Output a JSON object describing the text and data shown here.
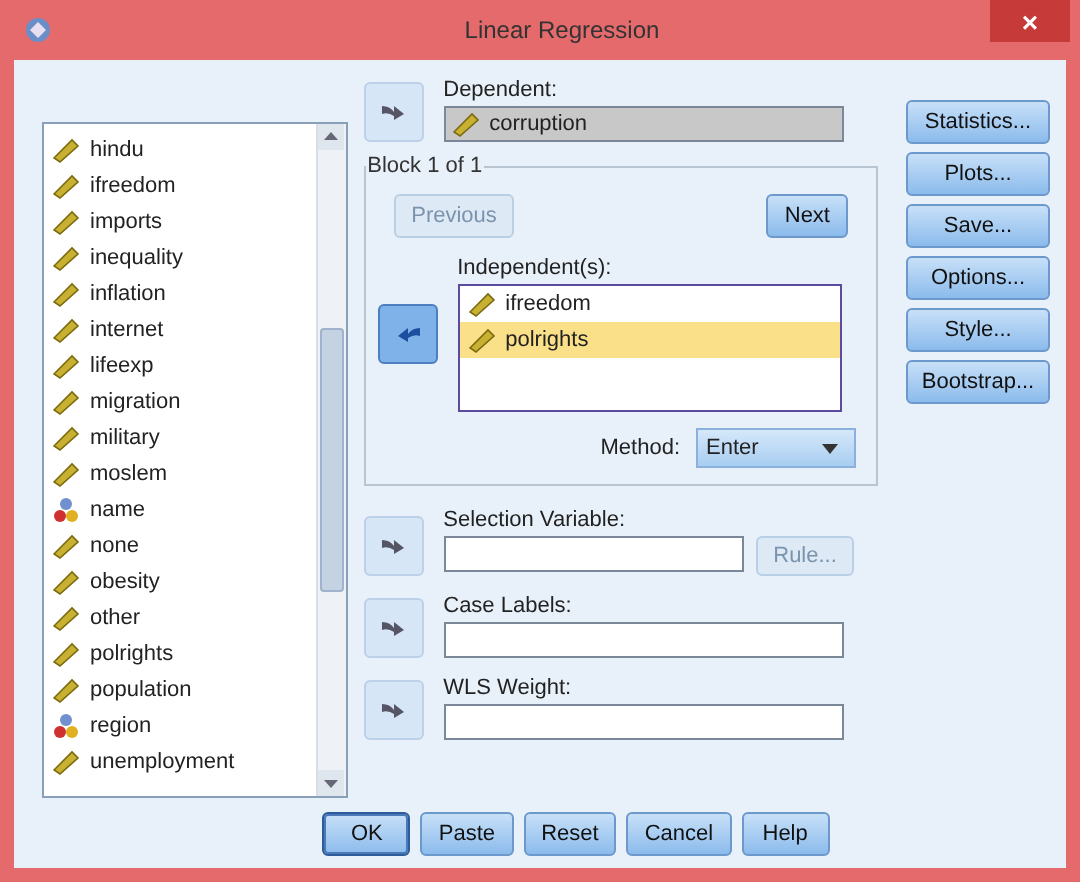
{
  "window": {
    "title": "Linear Regression",
    "close": "×"
  },
  "variables": [
    {
      "name": "hindu",
      "kind": "scale",
      "selected": false
    },
    {
      "name": "ifreedom",
      "kind": "scale",
      "selected": false
    },
    {
      "name": "imports",
      "kind": "scale",
      "selected": false
    },
    {
      "name": "inequality",
      "kind": "scale",
      "selected": false
    },
    {
      "name": "inflation",
      "kind": "scale",
      "selected": false
    },
    {
      "name": "internet",
      "kind": "scale",
      "selected": false
    },
    {
      "name": "lifeexp",
      "kind": "scale",
      "selected": false
    },
    {
      "name": "migration",
      "kind": "scale",
      "selected": false
    },
    {
      "name": "military",
      "kind": "scale",
      "selected": false
    },
    {
      "name": "moslem",
      "kind": "scale",
      "selected": false
    },
    {
      "name": "name",
      "kind": "nominal",
      "selected": false
    },
    {
      "name": "none",
      "kind": "scale",
      "selected": false
    },
    {
      "name": "obesity",
      "kind": "scale",
      "selected": false
    },
    {
      "name": "other",
      "kind": "scale",
      "selected": false
    },
    {
      "name": "polrights",
      "kind": "scale",
      "selected": false
    },
    {
      "name": "population",
      "kind": "scale",
      "selected": false
    },
    {
      "name": "region",
      "kind": "nominal",
      "selected": false
    },
    {
      "name": "unemployment",
      "kind": "scale",
      "selected": false
    }
  ],
  "dependent": {
    "label": "Dependent:",
    "value": "corruption",
    "kind": "scale"
  },
  "block": {
    "legend": "Block 1 of 1",
    "previous": {
      "label": "Previous",
      "disabled": true
    },
    "next": {
      "label": "Next",
      "disabled": false
    },
    "independents_label": "Independent(s):",
    "independents": [
      {
        "name": "ifreedom",
        "kind": "scale",
        "selected": false
      },
      {
        "name": "polrights",
        "kind": "scale",
        "selected": true
      }
    ],
    "method_label": "Method:",
    "method": "Enter"
  },
  "selection_variable": {
    "label": "Selection Variable:",
    "rule": {
      "label": "Rule...",
      "disabled": true
    }
  },
  "case_labels": {
    "label": "Case Labels:"
  },
  "wls_weight": {
    "label": "WLS Weight:"
  },
  "side_buttons": [
    "Statistics...",
    "Plots...",
    "Save...",
    "Options...",
    "Style...",
    "Bootstrap..."
  ],
  "bottom_buttons": [
    {
      "label": "OK",
      "default": true
    },
    {
      "label": "Paste",
      "default": false
    },
    {
      "label": "Reset",
      "default": false
    },
    {
      "label": "Cancel",
      "default": false
    },
    {
      "label": "Help",
      "default": false
    }
  ]
}
